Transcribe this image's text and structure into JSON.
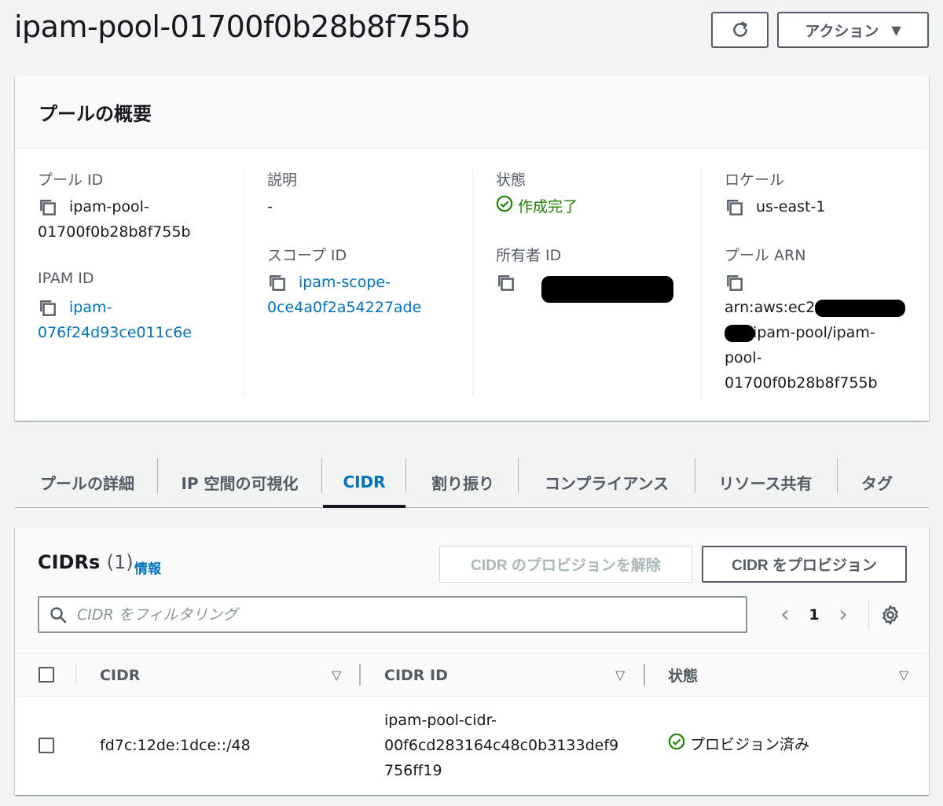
{
  "header": {
    "title": "ipam-pool-01700f0b28b8f755b",
    "actions_label": "アクション"
  },
  "summary": {
    "heading": "プールの概要",
    "pool_id": {
      "label": "プール ID",
      "value_line1": "ipam-pool-",
      "value_line2": "01700f0b28b8f755b"
    },
    "ipam_id": {
      "label": "IPAM ID",
      "value_line1": "ipam-",
      "value_line2": "076f24d93ce011c6e"
    },
    "description": {
      "label": "説明",
      "value": "-"
    },
    "scope_id": {
      "label": "スコープ ID",
      "value_line1": "ipam-scope-",
      "value_line2": "0ce4a0f2a54227ade"
    },
    "state": {
      "label": "状態",
      "value": "作成完了"
    },
    "owner_id": {
      "label": "所有者 ID"
    },
    "locale": {
      "label": "ロケール",
      "value": "us-east-1"
    },
    "pool_arn": {
      "label": "プール ARN",
      "line1": "arn:aws:ec2::",
      "line2": "ipam-pool/ipam-",
      "line3": "pool-",
      "line4": "01700f0b28b8f755b"
    }
  },
  "tabs": [
    {
      "label": "プールの詳細"
    },
    {
      "label": "IP 空間の可視化"
    },
    {
      "label": "CIDR"
    },
    {
      "label": "割り振り"
    },
    {
      "label": "コンプライアンス"
    },
    {
      "label": "リソース共有"
    },
    {
      "label": "タグ"
    }
  ],
  "cidrs": {
    "title": "CIDRs",
    "count": "(1)",
    "info_label": "情報",
    "deprovision_label": "CIDR のプロビジョンを解除",
    "provision_label": "CIDR をプロビジョン",
    "search_placeholder": "CIDR をフィルタリング",
    "page": "1",
    "columns": [
      "CIDR",
      "CIDR ID",
      "状態"
    ],
    "rows": [
      {
        "cidr": "fd7c:12de:1dce::/48",
        "cidr_id_line1": "ipam-pool-cidr-",
        "cidr_id_line2": "00f6cd283164c48c0b3133def9",
        "cidr_id_line3": "756ff19",
        "state": "プロビジョン済み"
      }
    ]
  },
  "colors": {
    "link": "#0073bb",
    "success": "#1d8102",
    "text": "#16191f",
    "muted": "#545b64"
  },
  "icons": [
    "refresh-icon",
    "caret-down-icon",
    "copy-icon",
    "check-circle-icon",
    "search-icon",
    "chevron-left-icon",
    "chevron-right-icon",
    "gear-icon",
    "sort-caret-icon"
  ]
}
